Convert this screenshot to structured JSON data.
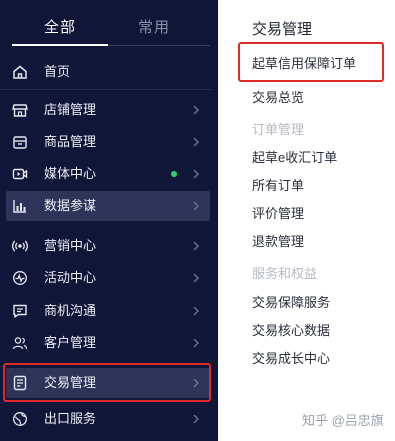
{
  "tabs": {
    "all_label": "全部",
    "common_label": "常用"
  },
  "sidebar": {
    "items": [
      {
        "label": "首页"
      },
      {
        "label": "店铺管理"
      },
      {
        "label": "商品管理"
      },
      {
        "label": "媒体中心"
      },
      {
        "label": "数据参谋"
      },
      {
        "label": "营销中心"
      },
      {
        "label": "活动中心"
      },
      {
        "label": "商机沟通"
      },
      {
        "label": "客户管理"
      },
      {
        "label": "交易管理"
      },
      {
        "label": "出口服务"
      }
    ]
  },
  "panel": {
    "title": "交易管理",
    "links": {
      "guarantee_order": "起草信用保障订单",
      "overview": "交易总览",
      "draft_ecollect": "起草e收汇订单",
      "all_orders": "所有订单",
      "reviews": "评价管理",
      "refunds": "退款管理",
      "guarantee_service": "交易保障服务",
      "core_data": "交易核心数据",
      "growth_center": "交易成长中心"
    },
    "groups": {
      "order_mgmt": "订单管理",
      "service_rights": "服务和权益"
    }
  },
  "watermark": "知乎 @吕忠旗",
  "colors": {
    "sidebar_bg": "#101637",
    "highlight_bg": "#2d3458",
    "annotation_red": "#e02a2a",
    "status_dot": "#2fd07a"
  }
}
